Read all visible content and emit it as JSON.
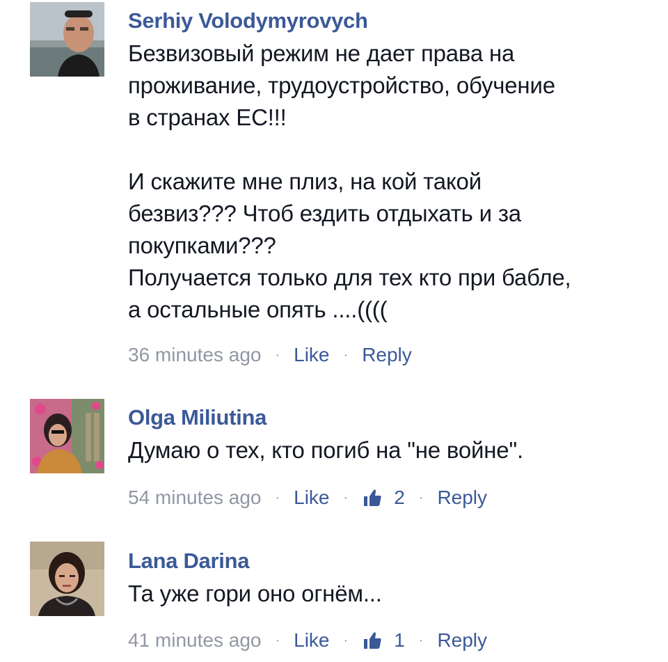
{
  "comments": [
    {
      "author": "Serhiy Volodymyrovych",
      "lines": [
        "Безвизовый режим не дает права на",
        "проживание, трудоустройство, обучение",
        "в странах ЕС!!!",
        "",
        "И скажите мне плиз, на кой такой",
        "безвиз??? Чтоб ездить отдыхать и за",
        "покупками???",
        "Получается только для тех кто при бабле,",
        "а остальные опять ....(((("
      ],
      "time": "36 minutes ago",
      "like_label": "Like",
      "reply_label": "Reply",
      "separator": "·"
    },
    {
      "author": "Olga Miliutina",
      "lines": [
        "Думаю о тех, кто погиб на  \"не войне\"."
      ],
      "time": "54 minutes ago",
      "like_label": "Like",
      "like_count": "2",
      "reply_label": "Reply",
      "separator": "·"
    },
    {
      "author": "Lana Darina",
      "lines": [
        "Та уже гори оно огнём..."
      ],
      "time": "41 minutes ago",
      "like_label": "Like",
      "like_count": "1",
      "reply_label": "Reply",
      "separator": "·"
    }
  ],
  "colors": {
    "author": "#3b5998",
    "link": "#3b5998",
    "meta": "#9197a3",
    "text": "#141823"
  },
  "icons": {
    "like_count_icon": "thumbs-up-icon"
  }
}
